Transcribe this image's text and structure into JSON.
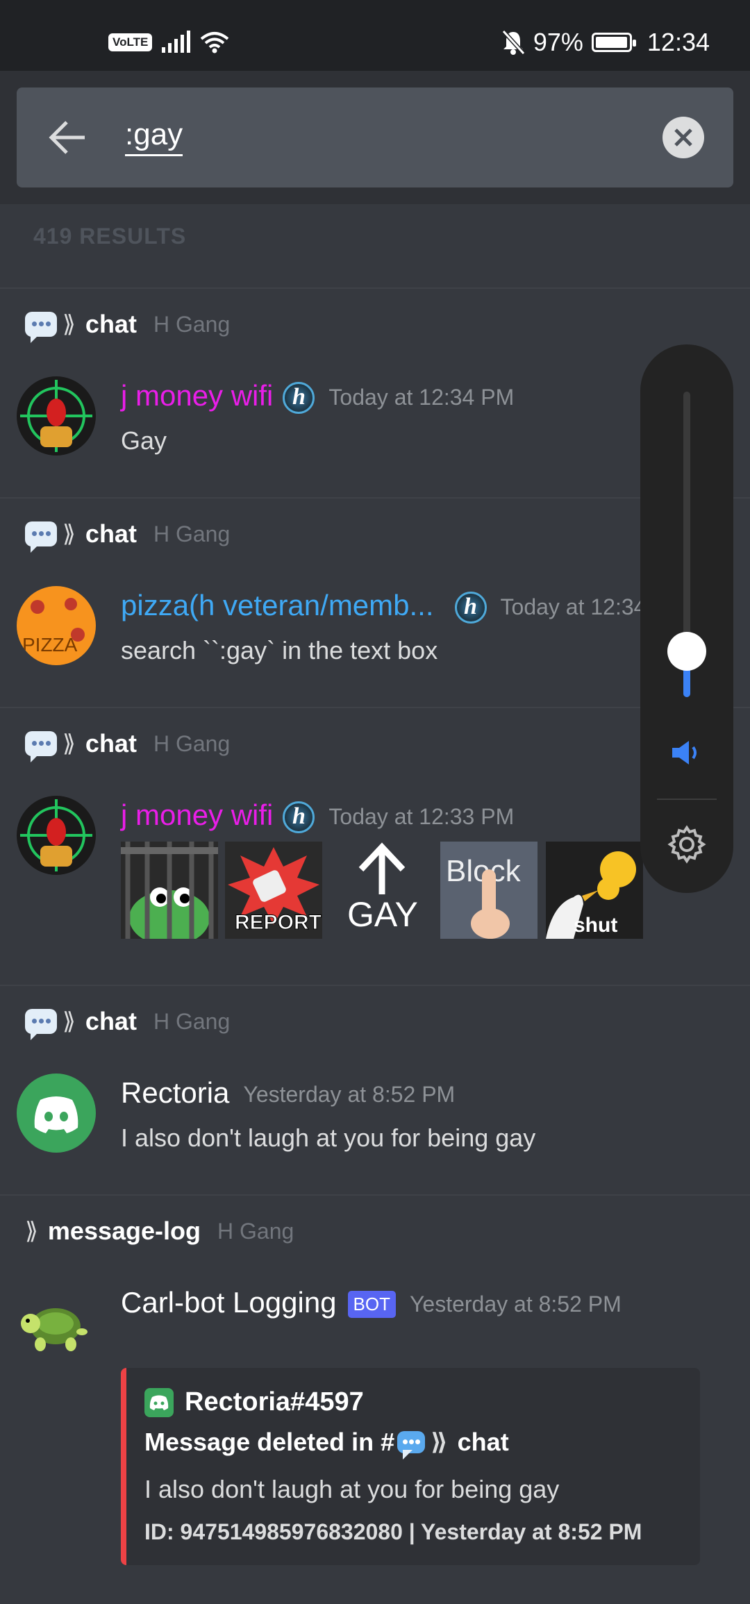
{
  "status_bar": {
    "volte": "VoLTE",
    "battery_percent": "97%",
    "battery_level": 0.97,
    "time": "12:34"
  },
  "search": {
    "query": ":gay",
    "back_icon": "arrow-left-icon",
    "clear_icon": "close-icon"
  },
  "results_count": "419 RESULTS",
  "results": [
    {
      "channel": "chat",
      "server": "H Gang",
      "author": "j money wifi",
      "author_color": "#e91ee8",
      "timestamp": "Today at 12:34 PM",
      "text": "Gay"
    },
    {
      "channel": "chat",
      "server": "H Gang",
      "author": "pizza(h veteran/memb...",
      "author_color": "#3fa9f5",
      "timestamp": "Today at 12:34 PM",
      "text": "search ``:gay` in the text box"
    },
    {
      "channel": "chat",
      "server": "H Gang",
      "author": "j money wifi",
      "author_color": "#e91ee8",
      "timestamp": "Today at 12:33 PM",
      "stickers": [
        {
          "name": "jail-pepe-sticker",
          "label": ""
        },
        {
          "name": "report-sticker",
          "label": "REPORT"
        },
        {
          "name": "up-arrow-gay-sticker",
          "label": "GAY"
        },
        {
          "name": "block-sticker",
          "label": "Block"
        },
        {
          "name": "shut-bird-sticker",
          "label": "shut"
        }
      ]
    },
    {
      "channel": "chat",
      "server": "H Gang",
      "author": "Rectoria",
      "author_color": "#ffffff",
      "timestamp": "Yesterday at 8:52 PM",
      "text": "I also don't laugh at you for being gay"
    },
    {
      "channel": "message-log",
      "server": "H Gang",
      "author": "Carl-bot Logging",
      "author_color": "#ffffff",
      "bot_tag": "BOT",
      "timestamp": "Yesterday at 8:52 PM",
      "embed": {
        "author": "Rectoria#4597",
        "title_prefix": "Message deleted in #",
        "title_channel": "chat",
        "description": "I also don't laugh at you for being gay",
        "footer": "ID: 947514985976832080 | Yesterday at 8:52 PM"
      }
    }
  ],
  "volume_overlay": {
    "level": 0.15,
    "speaker_icon": "speaker-icon",
    "settings_icon": "gear-icon"
  }
}
